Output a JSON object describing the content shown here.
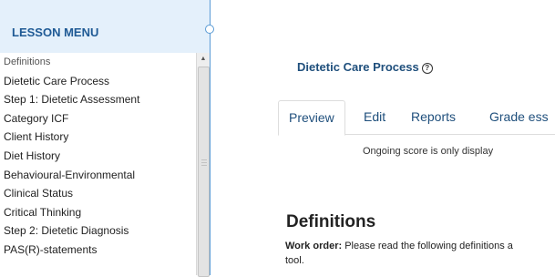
{
  "sidebar": {
    "title": "LESSON MENU",
    "items": [
      {
        "label": "Definitions",
        "active": true
      },
      {
        "label": "Dietetic Care Process"
      },
      {
        "label": "Step 1: Dietetic Assessment"
      },
      {
        "label": "Category ICF"
      },
      {
        "label": "Client History"
      },
      {
        "label": "Diet History"
      },
      {
        "label": "Behavioural-Environmental"
      },
      {
        "label": "Clinical Status"
      },
      {
        "label": "Critical Thinking"
      },
      {
        "label": "Step 2: Dietetic Diagnosis"
      },
      {
        "label": "PAS(R)-statements"
      }
    ]
  },
  "page": {
    "title": "Dietetic Care Process",
    "help_icon": "?",
    "tabs": [
      "Preview",
      "Edit",
      "Reports",
      "Grade ess"
    ],
    "notice": "Ongoing score is only display",
    "section_title": "Definitions",
    "work_order_label": "Work order:",
    "work_order_text": " Please read the following definitions a",
    "work_order_text2": "tool."
  },
  "colors": {
    "accent": "#1f5a95",
    "sidebar_bg": "#e4f0fb",
    "border": "#5a9bd5"
  },
  "icons": {
    "scroll_up": "triangle-up-icon",
    "help": "question-circle-icon"
  }
}
